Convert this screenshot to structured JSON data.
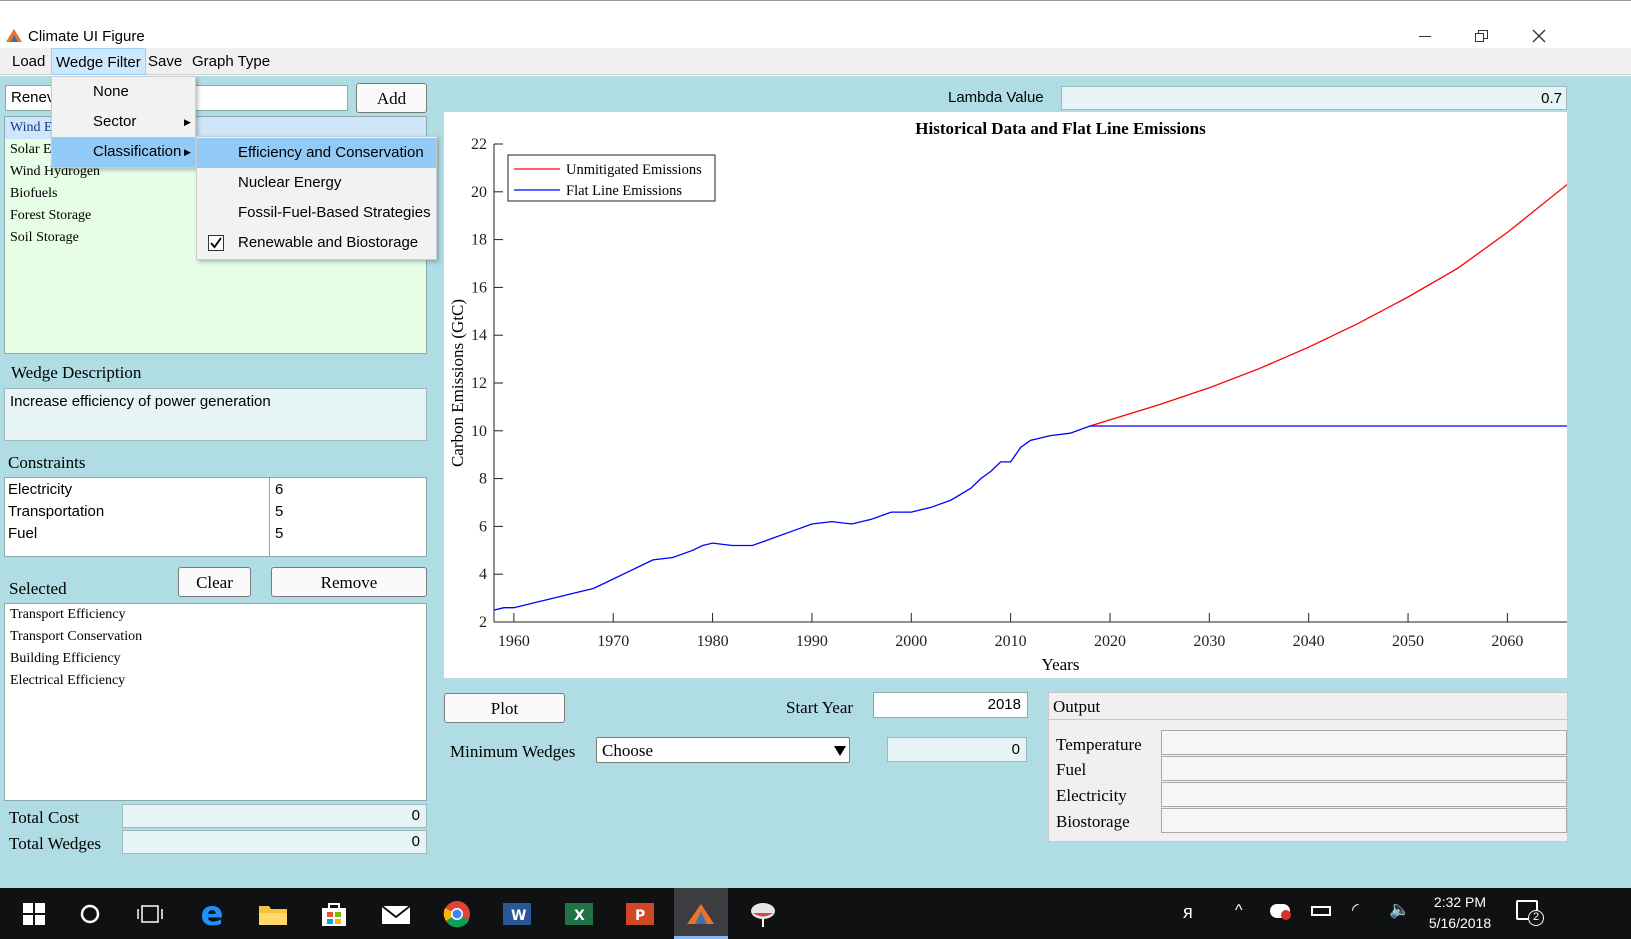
{
  "window": {
    "title": "Climate UI Figure"
  },
  "menubar": {
    "items": [
      "Load",
      "Wedge Filter",
      "Save",
      "Graph Type"
    ]
  },
  "filter_menu": {
    "items": [
      "None",
      "Sector",
      "Classification"
    ]
  },
  "classification_menu": {
    "items": [
      "Efficiency and Conservation",
      "Nuclear Energy",
      "Fossil-Fuel-Based Strategies",
      "Renewable and Biostorage"
    ],
    "checked": "Renewable and Biostorage"
  },
  "left": {
    "search_value": "Renev",
    "add_label": "Add",
    "wedge_list": [
      "Wind E",
      "Solar E",
      "Wind Hydrogen",
      "Biofuels",
      "Forest Storage",
      "Soil Storage"
    ],
    "wedge_desc_label": "Wedge Description",
    "wedge_desc_text": "Increase efficiency of power generation",
    "constraints_label": "Constraints",
    "constraints": [
      {
        "name": "Electricity",
        "value": "6"
      },
      {
        "name": "Transportation",
        "value": "5"
      },
      {
        "name": "Fuel",
        "value": "5"
      }
    ],
    "selected_label": "Selected",
    "clear_label": "Clear",
    "remove_label": "Remove",
    "selected_list": [
      "Transport Efficiency",
      "Transport Conservation",
      "Building Efficiency",
      "Electrical Efficiency"
    ],
    "total_cost_label": "Total Cost",
    "total_cost_value": "0",
    "total_wedges_label": "Total Wedges",
    "total_wedges_value": "0"
  },
  "right": {
    "lambda_label": "Lambda Value",
    "lambda_value": "0.7",
    "plot_label": "Plot",
    "start_year_label": "Start Year",
    "start_year_value": "2018",
    "min_wedges_label": "Minimum Wedges",
    "min_wedges_selected": "Choose",
    "min_wedges_value": "0",
    "output_label": "Output",
    "output_rows": [
      "Temperature",
      "Fuel",
      "Electricity",
      "Biostorage"
    ]
  },
  "chart_data": {
    "type": "line",
    "title": "Historical Data and Flat Line Emissions",
    "xlabel": "Years",
    "ylabel": "Carbon Emissions (GtC)",
    "xlim": [
      1958,
      2066
    ],
    "ylim": [
      2,
      22
    ],
    "xticks": [
      1960,
      1970,
      1980,
      1990,
      2000,
      2010,
      2020,
      2030,
      2040,
      2050,
      2060
    ],
    "yticks": [
      2,
      4,
      6,
      8,
      10,
      12,
      14,
      16,
      18,
      20,
      22
    ],
    "legend_position": "top-left",
    "series": [
      {
        "name": "Unmitigated Emissions",
        "color": "#ff0000",
        "x": [
          2018,
          2025,
          2030,
          2035,
          2040,
          2045,
          2050,
          2055,
          2060,
          2066
        ],
        "y": [
          10.2,
          11.1,
          11.8,
          12.6,
          13.5,
          14.5,
          15.6,
          16.8,
          18.3,
          20.3
        ]
      },
      {
        "name": "Flat Line Emissions",
        "color": "#0000ff",
        "x": [
          1958,
          1959,
          1960,
          1962,
          1964,
          1966,
          1968,
          1970,
          1972,
          1974,
          1976,
          1978,
          1979,
          1980,
          1982,
          1984,
          1986,
          1988,
          1990,
          1992,
          1994,
          1996,
          1998,
          2000,
          2002,
          2004,
          2006,
          2007,
          2008,
          2009,
          2010,
          2011,
          2012,
          2014,
          2016,
          2018,
          2025,
          2030,
          2040,
          2050,
          2060,
          2066
        ],
        "y": [
          2.5,
          2.6,
          2.6,
          2.8,
          3.0,
          3.2,
          3.4,
          3.8,
          4.2,
          4.6,
          4.7,
          5.0,
          5.2,
          5.3,
          5.2,
          5.2,
          5.5,
          5.8,
          6.1,
          6.2,
          6.1,
          6.3,
          6.6,
          6.6,
          6.8,
          7.1,
          7.6,
          8.0,
          8.3,
          8.7,
          8.7,
          9.3,
          9.6,
          9.8,
          9.9,
          10.2,
          10.2,
          10.2,
          10.2,
          10.2,
          10.2,
          10.2
        ]
      }
    ]
  },
  "taskbar": {
    "time": "2:32 PM",
    "date": "5/16/2018",
    "notification_count": "2"
  }
}
